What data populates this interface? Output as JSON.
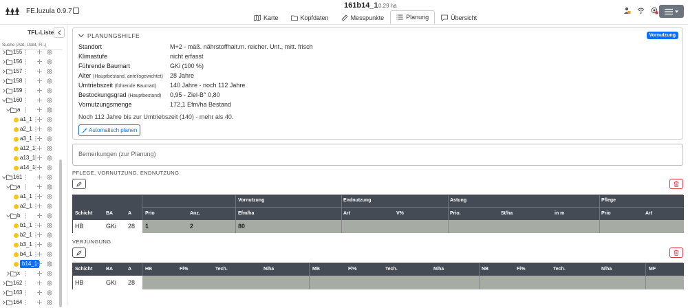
{
  "app": {
    "name": "FE.luzula 0.9.7"
  },
  "header": {
    "plot_id": "161b14_1",
    "plot_area": "0.29 ha"
  },
  "tabs": [
    {
      "label": "Karte",
      "icon": "map-icon"
    },
    {
      "label": "Kopfdaten",
      "icon": "folder-icon"
    },
    {
      "label": "Messpunkte",
      "icon": "ruler-icon"
    },
    {
      "label": "Planung",
      "icon": "list-icon",
      "active": true
    },
    {
      "label": "Übersicht",
      "icon": "chat-icon"
    }
  ],
  "sidebar": {
    "title": "TFL-Liste",
    "search_placeholder": "Suche (Abt, Uabt, Fl..)",
    "items": [
      {
        "label": "155",
        "type": "folder",
        "level": 0,
        "open": false
      },
      {
        "label": "156",
        "type": "folder",
        "level": 0,
        "open": false
      },
      {
        "label": "157",
        "type": "folder",
        "level": 0,
        "open": false
      },
      {
        "label": "158",
        "type": "folder",
        "level": 0,
        "open": false
      },
      {
        "label": "159",
        "type": "folder",
        "level": 0,
        "open": false
      },
      {
        "label": "160",
        "type": "folder",
        "level": 0,
        "open": true
      },
      {
        "label": "a",
        "type": "folder",
        "level": 1,
        "open": true
      },
      {
        "label": "a1_1",
        "type": "leaf",
        "level": 2
      },
      {
        "label": "a2_1",
        "type": "leaf",
        "level": 2
      },
      {
        "label": "a3_1",
        "type": "leaf",
        "level": 2
      },
      {
        "label": "a12_1",
        "type": "leaf",
        "level": 2
      },
      {
        "label": "a13_1",
        "type": "leaf",
        "level": 2
      },
      {
        "label": "a14_1",
        "type": "leaf",
        "level": 2
      },
      {
        "label": "161",
        "type": "folder",
        "level": 0,
        "open": true
      },
      {
        "label": "a",
        "type": "folder",
        "level": 1,
        "open": true
      },
      {
        "label": "a1_1",
        "type": "leaf",
        "level": 2
      },
      {
        "label": "a2_1",
        "type": "leaf",
        "level": 2
      },
      {
        "label": "b",
        "type": "folder",
        "level": 1,
        "open": true
      },
      {
        "label": "b1_1",
        "type": "leaf",
        "level": 2
      },
      {
        "label": "b2_1",
        "type": "leaf",
        "level": 2
      },
      {
        "label": "b3_1",
        "type": "leaf",
        "level": 2
      },
      {
        "label": "b4_1",
        "type": "leaf",
        "level": 2
      },
      {
        "label": "b14_1",
        "type": "leaf",
        "level": 2,
        "selected": true
      },
      {
        "label": "x",
        "type": "folder",
        "level": 1,
        "open": false
      },
      {
        "label": "162",
        "type": "folder",
        "level": 0,
        "open": false
      },
      {
        "label": "163",
        "type": "folder",
        "level": 0,
        "open": false
      },
      {
        "label": "164",
        "type": "folder",
        "level": 0,
        "open": false
      }
    ]
  },
  "planungshilfe": {
    "title": "PLANUNGSHILFE",
    "badge": "Vornutzung",
    "rows": [
      {
        "key": "Standort",
        "sub": "",
        "value": "M+2 - mäß. nährstoffhalt.m. reicher. Unt., mitt. frisch"
      },
      {
        "key": "Klimastufe",
        "sub": "",
        "value": "nicht erfasst"
      },
      {
        "key": "Führende Baumart",
        "sub": "",
        "value": "GKi (100 %)"
      },
      {
        "key": "Alter",
        "sub": "(Hauptbestand, anteilsgewichtet)",
        "value": "28 Jahre"
      },
      {
        "key": "Umtriebszeit",
        "sub": "(führende Baumart)",
        "value": "140 Jahre - noch 112 Jahre"
      },
      {
        "key": "Bestockungsgrad",
        "sub": "(Hauptbestand)",
        "value": "0,95 - Ziel-B° 0,80"
      },
      {
        "key": "Vornutzungsmenge",
        "sub": "",
        "value": "172,1 Efm/ha Bestand"
      }
    ],
    "note": "Noch 112 Jahre bis zur Umtriebszeit (140) - mehr als 40.",
    "auto_button": "Automatisch planen"
  },
  "remarks": {
    "placeholder": "Bemerkungen (zur Planung)"
  },
  "pflege": {
    "title": "PFLEGE, VORNUTZUNG, ENDNUTZUNG",
    "groups": [
      "Vornutzung",
      "Endnutzung",
      "Astung",
      "Pflege"
    ],
    "columns": [
      "Schicht",
      "BA",
      "A",
      "Prio",
      "Anz.",
      "Efm/ha",
      "Art",
      "V%",
      "Prio.",
      "St/ha",
      "in m",
      "Prio",
      "Art"
    ],
    "rows": [
      [
        "HB",
        "GKi",
        "28",
        "1",
        "2",
        "80",
        "",
        "",
        "",
        "",
        "",
        "",
        ""
      ]
    ]
  },
  "verjuengung": {
    "title": "VERJÜNGUNG",
    "columns": [
      "Schicht",
      "BA",
      "A",
      "HB",
      "Fl%",
      "Tech.",
      "N/ha",
      "MB",
      "Fl%",
      "Tech.",
      "N/ha",
      "NB",
      "Fl%",
      "Tech.",
      "N/ha",
      "MF"
    ],
    "rows": [
      [
        "HB",
        "GKi",
        "28",
        "",
        "",
        "",
        "",
        "",
        "",
        "",
        "",
        "",
        "",
        "",
        "",
        ""
      ]
    ]
  }
}
